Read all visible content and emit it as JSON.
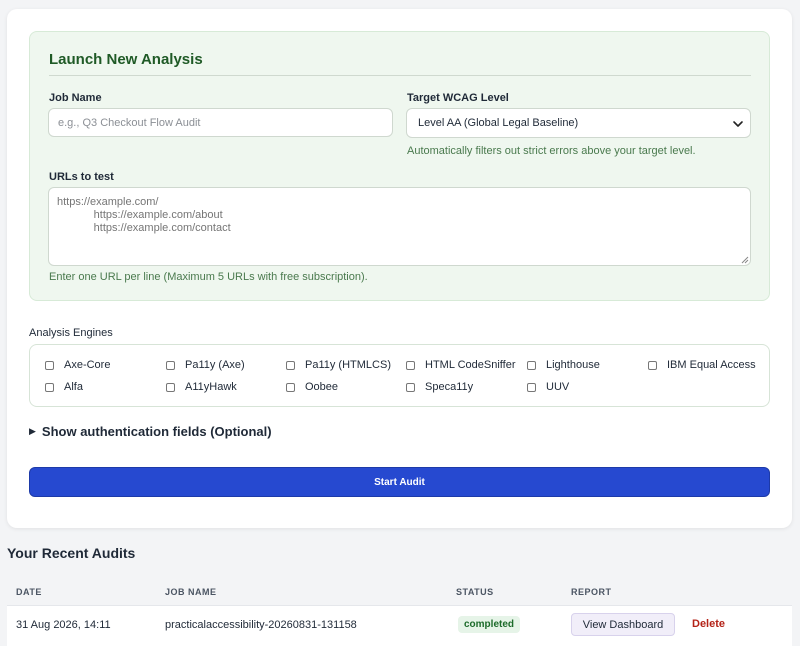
{
  "launch": {
    "title": "Launch New Analysis",
    "job_name_label": "Job Name",
    "job_name_value": "",
    "job_name_placeholder": "e.g., Q3 Checkout Flow Audit",
    "wcag_label": "Target WCAG Level",
    "wcag_selected": "Level AA (Global Legal Baseline)",
    "wcag_hint": "Automatically filters out strict errors above your target level.",
    "urls_label": "URLs to test",
    "urls_placeholder": "https://example.com/\n            https://example.com/about\n            https://example.com/contact",
    "urls_hint": "Enter one URL per line (Maximum 5 URLs with free subscription)."
  },
  "engines": {
    "label": "Analysis Engines",
    "items": [
      {
        "label": "Axe-Core",
        "checked": false
      },
      {
        "label": "Pa11y (Axe)",
        "checked": false
      },
      {
        "label": "Pa11y (HTMLCS)",
        "checked": false
      },
      {
        "label": "HTML CodeSniffer",
        "checked": false
      },
      {
        "label": "Lighthouse",
        "checked": false
      },
      {
        "label": "IBM Equal Access",
        "checked": false
      },
      {
        "label": "Alfa",
        "checked": false
      },
      {
        "label": "A11yHawk",
        "checked": false
      },
      {
        "label": "Oobee",
        "checked": false
      },
      {
        "label": "Speca11y",
        "checked": false
      },
      {
        "label": "UUV",
        "checked": false
      }
    ]
  },
  "auth": {
    "label": "Show authentication fields (Optional)"
  },
  "start_button": "Start Audit",
  "recent": {
    "title": "Your Recent Audits",
    "columns": [
      "DATE",
      "JOB NAME",
      "STATUS",
      "REPORT"
    ],
    "rows": [
      {
        "date": "31 Aug 2026, 14:11",
        "job_name": "practicalaccessibility-20260831-131158",
        "status": "completed",
        "view_label": "View Dashboard",
        "delete_label": "Delete"
      }
    ]
  },
  "colors": {
    "primary_button": "#2649d0",
    "panel_bg": "#eff7ef",
    "heading_green": "#1f5a26",
    "status_completed": "#1c6b2a",
    "delete_red": "#b42318"
  }
}
